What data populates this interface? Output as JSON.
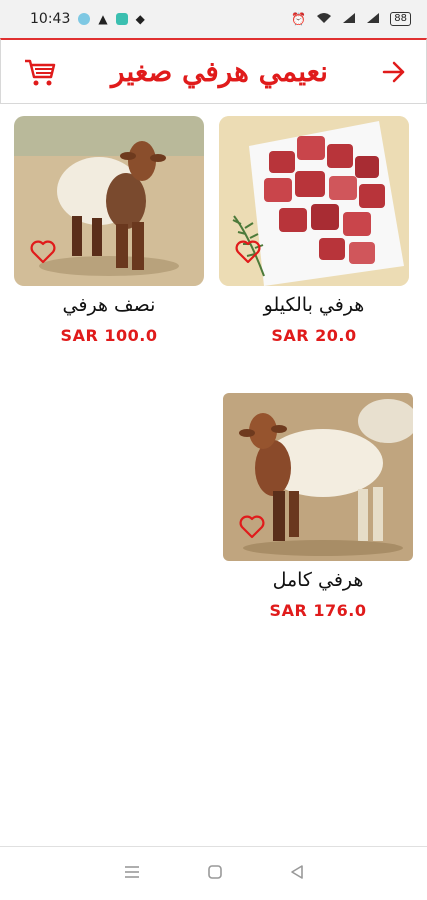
{
  "status_bar": {
    "time": "10:43",
    "battery": "88"
  },
  "header": {
    "title": "نعيمي هرفي صغير",
    "icons": {
      "cart": "cart-icon",
      "back": "arrow-right-icon"
    }
  },
  "products": [
    {
      "name": "هرفي بالكيلو",
      "price": "SAR 20.0",
      "image": "raw-meat-cubes"
    },
    {
      "name": "نصف هرفي",
      "price": "SAR 100.0",
      "image": "brown-headed-sheep"
    },
    {
      "name": "هرفي كامل",
      "price": "SAR 176.0",
      "image": "brown-headed-sheep"
    }
  ],
  "colors": {
    "accent": "#e01b1b",
    "header_border": "#e03030"
  }
}
